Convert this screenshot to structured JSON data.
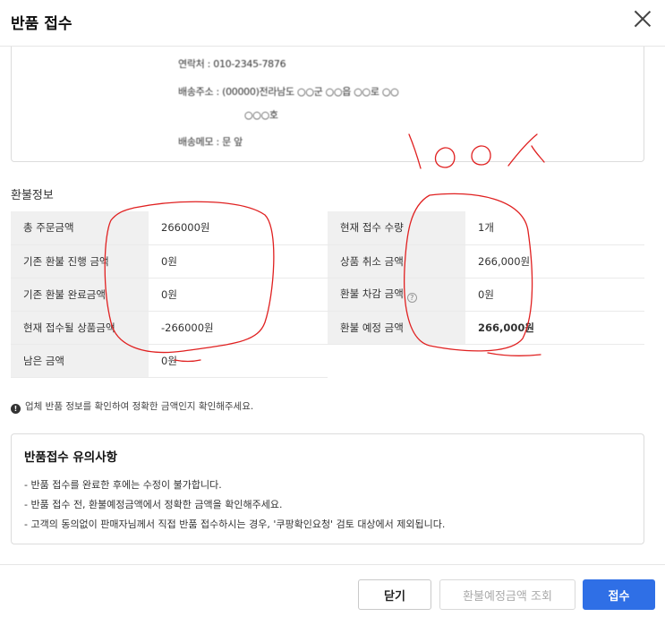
{
  "modal": {
    "title": "반품 접수"
  },
  "address": {
    "contact": "연락처 : 010-2345-7876",
    "address_line1": "배송주소 : (00000)전라남도 ○○군 ○○읍 ○○로 ○○",
    "address_line2": "○○○호",
    "delivery_memo": "배송메모 : 문 앞"
  },
  "refund_info": {
    "section_title": "환불정보",
    "left": [
      {
        "label": "총 주문금액",
        "value": "266000원",
        "style": "normal"
      },
      {
        "label": "기존 환불 진행 금액",
        "value": "0원",
        "style": "normal"
      },
      {
        "label": "기존 환불 완료금액",
        "value": "0원",
        "style": "normal"
      },
      {
        "label": "현재 접수될 상품금액",
        "value": "-266000원",
        "style": "red"
      },
      {
        "label": "남은 금액",
        "value": "0원",
        "style": "normal"
      }
    ],
    "right": [
      {
        "label": "현재 접수 수량",
        "value": "1개",
        "style": "normal"
      },
      {
        "label": "상품 취소 금액",
        "value": "266,000원",
        "style": "normal"
      },
      {
        "label": "환불 차감 금액",
        "value": "0원",
        "style": "normal",
        "help_icon": "?"
      },
      {
        "label": "환불 예정 금액",
        "value": "266,000원",
        "style": "bold"
      }
    ]
  },
  "notice": {
    "icon": "!",
    "text": "업체 반품 정보를 확인하여 정확한 금액인지 확인해주세요."
  },
  "caution": {
    "title": "반품접수 유의사항",
    "items": [
      "- 반품 접수를 완료한 후에는 수정이 불가합니다.",
      "- 반품 접수 전, 환불예정금액에서 정확한 금액을 확인해주세요.",
      "- 고객의 동의없이 판매자님께서 직접 반품 접수하시는 경우, '쿠팡확인요청' 검토 대상에서 제외됩니다."
    ]
  },
  "footer": {
    "close_label": "닫기",
    "query_label": "환불예정금액 조회",
    "submit_label": "접수"
  },
  "annotation": {
    "text": "100%",
    "color": "#e02020"
  },
  "colors": {
    "primary": "#2f6fe6",
    "negative": "#e03c3c",
    "scribble": "#e02020"
  }
}
